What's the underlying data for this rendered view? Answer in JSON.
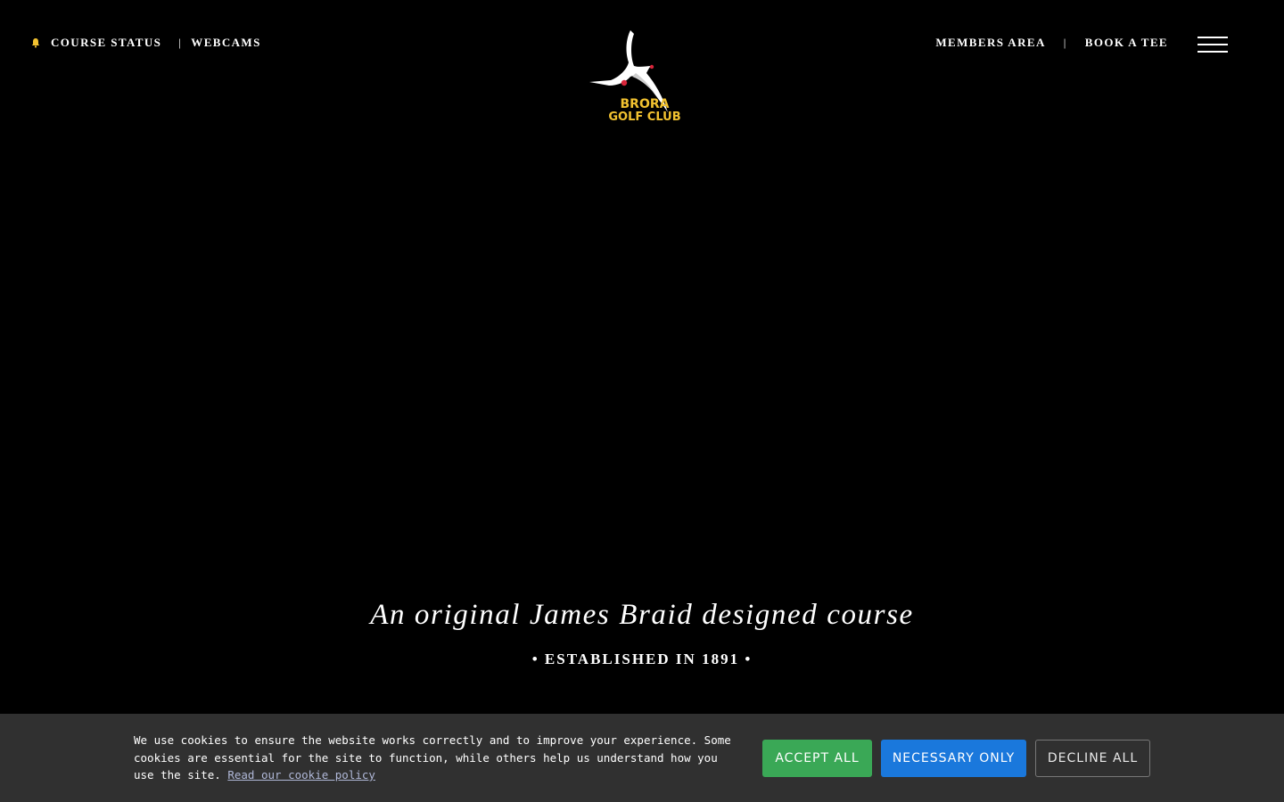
{
  "nav_left": {
    "course_status": "COURSE STATUS",
    "separator": "|",
    "webcams": "WEBCAMS"
  },
  "nav_right": {
    "members_area": "MEMBERS AREA",
    "separator": "|",
    "book_a_tee": "BOOK A TEE"
  },
  "logo": {
    "line1": "BRORA",
    "line2": "GOLF CLUB"
  },
  "hero": {
    "title": "An original James Braid designed course",
    "subtitle": "• ESTABLISHED IN 1891 •"
  },
  "cookie_banner": {
    "text": "We use cookies to ensure the website works correctly and to improve your experience. Some cookies are essential for the site to function, while others help us understand how you use the site. ",
    "link": "Read our cookie policy",
    "accept_all": "ACCEPT ALL",
    "necessary_only": "NECESSARY ONLY",
    "decline_all": "DECLINE ALL"
  },
  "colors": {
    "background": "#000000",
    "banner": "#303030",
    "accept": "#3aa856",
    "necessary": "#1a78dc",
    "logo_text": "#f2c230"
  },
  "icons": [
    "bell-icon",
    "menu-icon",
    "tern-bird-logo"
  ]
}
